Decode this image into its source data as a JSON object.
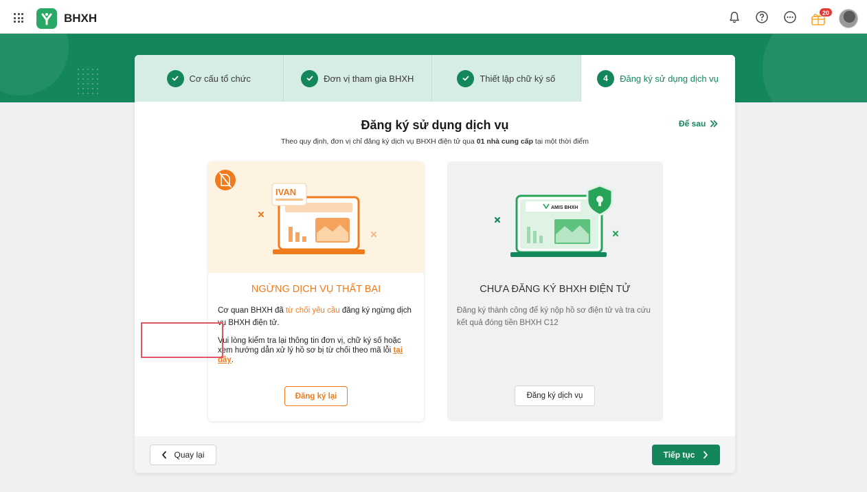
{
  "header": {
    "app_title": "BHXH",
    "notification_count": "20"
  },
  "steps": [
    {
      "label": "Cơ cấu tổ chức",
      "state": "done"
    },
    {
      "label": "Đơn vị tham gia BHXH",
      "state": "done"
    },
    {
      "label": "Thiết lập chữ ký số",
      "state": "done"
    },
    {
      "label": "Đăng ký sử dụng dịch vụ",
      "number": "4",
      "state": "active"
    }
  ],
  "page": {
    "title": "Đăng ký sử dụng dịch vụ",
    "subtitle_before": "Theo quy định, đơn vị chỉ đăng ký dịch vụ BHXH điện tử qua ",
    "subtitle_bold": "01 nhà cung cấp",
    "subtitle_after": " tại một thời điểm",
    "later_label": "Để sau"
  },
  "left_option": {
    "illus_label": "IVAN",
    "title": "NGỪNG DỊCH VỤ THẤT BẠI",
    "text1_before": "Cơ quan BHXH đã ",
    "text1_highlight": "từ chối yêu cầu",
    "text1_after": " đăng ký ngừng dịch vụ BHXH điện tử.",
    "text2_before": "Vui lòng kiểm tra lại thông tin đơn vị, chữ ký số hoặc xem hướng dẫn xử lý hồ sơ bị từ chối theo mã lỗi ",
    "text2_link": "tại đây",
    "text2_after": ".",
    "button_label": "Đăng ký lại"
  },
  "right_option": {
    "illus_label": "AMIS BHXH",
    "title": "CHƯA ĐĂNG KÝ BHXH ĐIỆN TỬ",
    "text": "Đăng ký thành công để ký nộp hồ sơ điện tử và tra cứu kết quả đóng tiền BHXH C12",
    "button_label": "Đăng ký dịch vụ"
  },
  "footer": {
    "back_label": "Quay lại",
    "next_label": "Tiếp tục"
  },
  "colors": {
    "brand_green": "#13875b",
    "accent_orange": "#f07b1d",
    "highlight_red": "#e05563"
  },
  "icons": [
    "apps-grid-icon",
    "logo-icon",
    "bell-icon",
    "help-icon",
    "more-icon",
    "gift-icon",
    "check-icon",
    "double-chevron-right-icon",
    "chevron-left-icon",
    "chevron-right-icon",
    "document-error-icon",
    "shield-icon"
  ]
}
